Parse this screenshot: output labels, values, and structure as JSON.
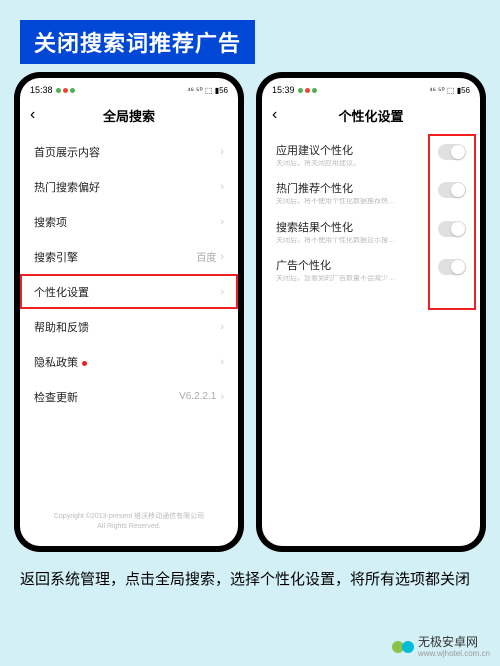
{
  "banner": "关闭搜索词推荐广告",
  "caption": "返回系统管理，点击全局搜索，选择个性化设置，将所有选项都关闭",
  "watermark": {
    "name": "无极安卓网",
    "url": "www.wjhotel.com.cn"
  },
  "left": {
    "time": "15:38",
    "signal": "⁴⁶ ⁵⁰ ⬚ ▮56",
    "title": "全局搜索",
    "rows": [
      {
        "label": "首页展示内容",
        "value": ""
      },
      {
        "label": "热门搜索偏好",
        "value": ""
      },
      {
        "label": "搜索项",
        "value": ""
      },
      {
        "label": "搜索引擎",
        "value": "百度"
      },
      {
        "label": "个性化设置",
        "value": "",
        "highlight": true
      },
      {
        "label": "帮助和反馈",
        "value": ""
      },
      {
        "label": "隐私政策",
        "value": "",
        "dot": true
      },
      {
        "label": "检查更新",
        "value": "V6.2.2.1"
      }
    ],
    "footer1": "Copyright ©2013-present 维沃移动通信有限公司",
    "footer2": "All Rights Reserved."
  },
  "right": {
    "time": "15:39",
    "signal": "⁴⁶ ⁵⁰ ⬚ ▮56",
    "title": "个性化设置",
    "items": [
      {
        "label": "应用建议个性化",
        "desc": "关闭后，将关闭应用建议。"
      },
      {
        "label": "热门推荐个性化",
        "desc": "关闭后，将不使用个性化数据推荐热门推荐内容。"
      },
      {
        "label": "搜索结果个性化",
        "desc": "关闭后，将不使用个性化数据显示搜索结果及对结果排序。"
      },
      {
        "label": "广告个性化",
        "desc": "关闭后，您看到的广告数量不会减少，但将不使用个性化数据显示广告。"
      }
    ]
  }
}
